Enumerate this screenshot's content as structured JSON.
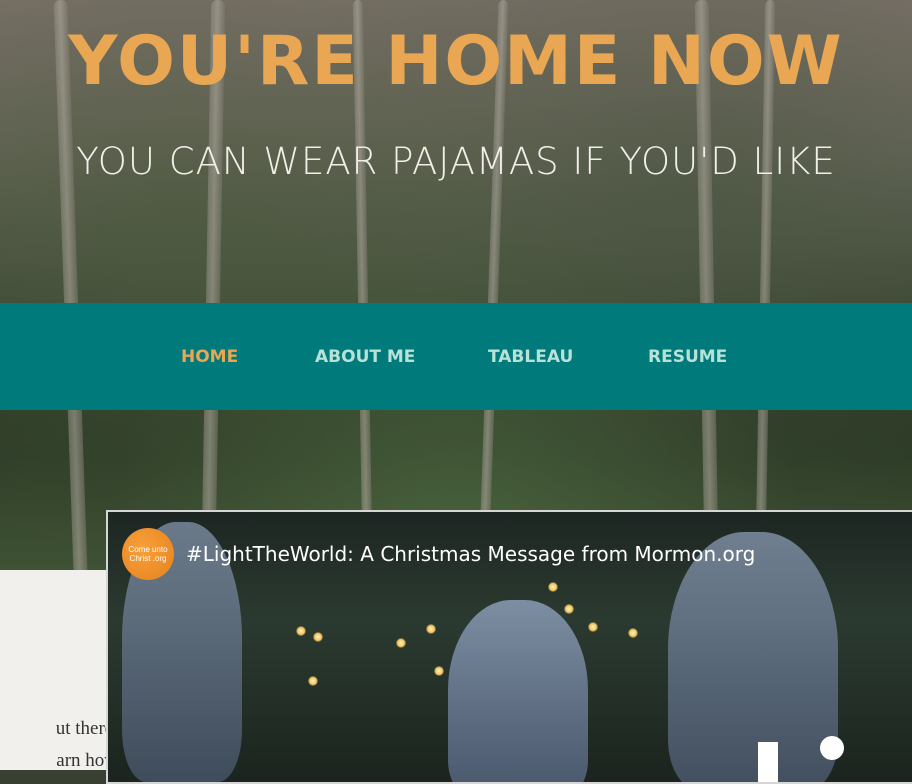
{
  "hero": {
    "title": "YOU'RE HOME NOW",
    "subtitle": "YOU CAN WEAR PAJAMAS IF YOU'D LIKE"
  },
  "nav": {
    "items": [
      {
        "label": "HOME",
        "active": true
      },
      {
        "label": "ABOUT ME",
        "active": false
      },
      {
        "label": "TABLEAU",
        "active": false
      },
      {
        "label": "RESUME",
        "active": false
      }
    ]
  },
  "side_card": {
    "line1": "ut there.",
    "line2": "arn how"
  },
  "video": {
    "title": "#LightTheWorld: A Christmas Message from Mormon.org",
    "channel_logo_text": "Come unto Christ .org"
  },
  "colors": {
    "accent": "#e9a653",
    "nav_bg": "#017a7c",
    "nav_text": "#b7e2d7"
  }
}
